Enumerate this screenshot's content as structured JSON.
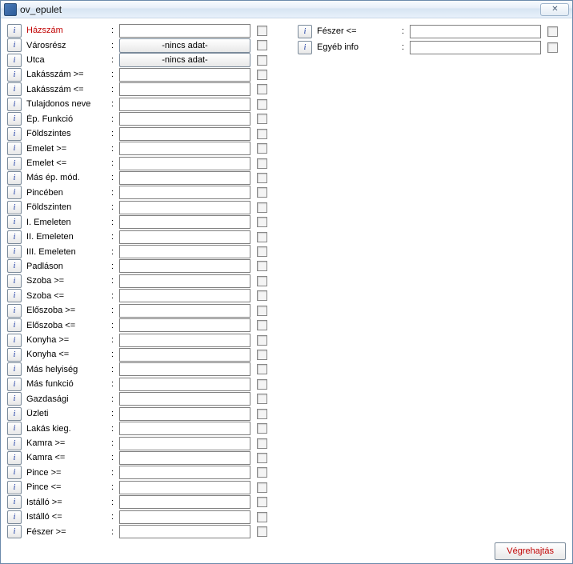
{
  "window": {
    "title": "ov_epulet",
    "close_glyph": "✕"
  },
  "info_btn_label": "i",
  "dropdown_placeholder": "-nincs adat-",
  "col1": [
    {
      "label": "Házszám",
      "type": "text",
      "red": true
    },
    {
      "label": "Városrész",
      "type": "dropdown"
    },
    {
      "label": "Utca",
      "type": "dropdown"
    },
    {
      "label": "Lakásszám >=",
      "type": "text"
    },
    {
      "label": "Lakásszám <=",
      "type": "text"
    },
    {
      "label": "Tulajdonos neve",
      "type": "text"
    },
    {
      "label": "Ép. Funkció",
      "type": "text"
    },
    {
      "label": "Földszintes",
      "type": "text"
    },
    {
      "label": "Emelet >=",
      "type": "text"
    },
    {
      "label": "Emelet <=",
      "type": "text"
    },
    {
      "label": "Más ép. mód.",
      "type": "text"
    },
    {
      "label": "Pincében",
      "type": "text"
    },
    {
      "label": "Földszinten",
      "type": "text"
    },
    {
      "label": "I. Emeleten",
      "type": "text"
    },
    {
      "label": "II. Emeleten",
      "type": "text"
    },
    {
      "label": "III. Emeleten",
      "type": "text"
    },
    {
      "label": "Padláson",
      "type": "text"
    },
    {
      "label": "Szoba >=",
      "type": "text"
    },
    {
      "label": "Szoba <=",
      "type": "text"
    },
    {
      "label": "Előszoba >=",
      "type": "text"
    },
    {
      "label": "Előszoba <=",
      "type": "text"
    },
    {
      "label": "Konyha >=",
      "type": "text"
    },
    {
      "label": "Konyha <=",
      "type": "text"
    },
    {
      "label": "Más helyiség",
      "type": "text"
    },
    {
      "label": "Más funkció",
      "type": "text"
    },
    {
      "label": "Gazdasági",
      "type": "text"
    },
    {
      "label": "Üzleti",
      "type": "text"
    },
    {
      "label": "Lakás kieg.",
      "type": "text"
    },
    {
      "label": "Kamra >=",
      "type": "text"
    },
    {
      "label": "Kamra <=",
      "type": "text"
    },
    {
      "label": "Pince >=",
      "type": "text"
    },
    {
      "label": "Pince <=",
      "type": "text"
    },
    {
      "label": "Istálló >=",
      "type": "text"
    },
    {
      "label": "Istálló <=",
      "type": "text"
    },
    {
      "label": "Fészer >=",
      "type": "text"
    }
  ],
  "col2": [
    {
      "label": "Fészer <=",
      "type": "text"
    },
    {
      "label": "Egyéb info",
      "type": "text"
    }
  ],
  "footer": {
    "execute_label": "Végrehajtás"
  }
}
